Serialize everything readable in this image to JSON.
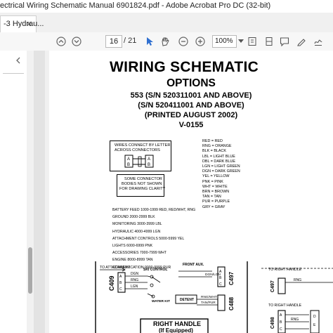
{
  "window": {
    "title": "ectrical Wiring Schematic Manual 6901824.pdf - Adobe Acrobat Pro DC (32-bit)"
  },
  "tab": {
    "label": "-3 Hydrau...",
    "close_label": "×"
  },
  "toolbar": {
    "page_current": "16",
    "page_total": "/ 21",
    "zoom": "100%"
  },
  "colors": {
    "panel_grey": "#e3e3e3",
    "toolbar_bg": "#f7f7f7"
  },
  "document": {
    "title": "WIRING SCHEMATIC",
    "subtitle": "OPTIONS",
    "line1": "553 (S/N 520311001 AND ABOVE)",
    "line2": "(S/N 520411001 AND ABOVE)",
    "line3": "(PRINTED AUGUST 2002)",
    "line4": "V-0155",
    "wires_note": "WIRES CONNECT BY LETTER ACROSS CONNECTORS",
    "wires_note_l1": "WIRES CONNECT BY LETTER",
    "wires_note_l2": "ACROSS CONNECTORS",
    "conn_note_l1": "SOME CONNECTOR",
    "conn_note_l2": "BODIES NOT SHOWN",
    "conn_note_l3": "FOR DRAWING CLARITY",
    "color_legend": [
      "RED = RED",
      "RNG = ORANGE",
      "BLK = BLACK",
      "LBL = LIGHT BLUE",
      "DBL = DARK BLUE",
      "LGN = LIGHT GREEN",
      "DGN = DARK GREEN",
      "YEL = YELLOW",
      "PNK = PINK",
      "WHT = WHITE",
      "BRN = BROWN",
      "TAN = TAN",
      "PUR = PURPLE",
      "GRY = GRAY"
    ],
    "circuits": [
      "BATTERY FEED 1000-1999 RED, RED/WHT, RNG",
      "GROUND 2000-2999 BLK",
      "MONITORING 3000-3999 LBL",
      "HYDRAULIC 4000-4999 LGN",
      "ATTACHMENT CONTROLS 5000-5999 YEL",
      "LIGHTS 6000-6999 PNK",
      "ACCESSORIES 7000-7999 WHT",
      "ENGINE 8000-8999 TAN",
      "COMMUNICATION 9000-9999 PUR"
    ],
    "schematic": {
      "to_attachment": "TO ATTACHMENT",
      "c409": "C409",
      "dgn": "DGN",
      "rng": "RNG",
      "lgn": "LGN",
      "ski_control": "SKI CONTROL",
      "front_aux": "FRONT AUX.",
      "dgn_lgn_label": "DGN/LGN",
      "c497": "C497",
      "water_kit": "WATER KIT",
      "detent": "DETENT",
      "rng_wht": "RNG/WHT",
      "tan_pur": "TAN/PUR",
      "c488": "C488",
      "right_handle": "RIGHT HANDLE",
      "if_equipped": "(If Equipped)",
      "to_right_handle_1": "TO RIGHT HANDLE",
      "to_right_handle_2": "TO RIGHT HANDLE",
      "c497b": "C497",
      "c498": "C498",
      "a": "A",
      "b": "B",
      "c": "C",
      "d": "D",
      "e": "E"
    }
  }
}
